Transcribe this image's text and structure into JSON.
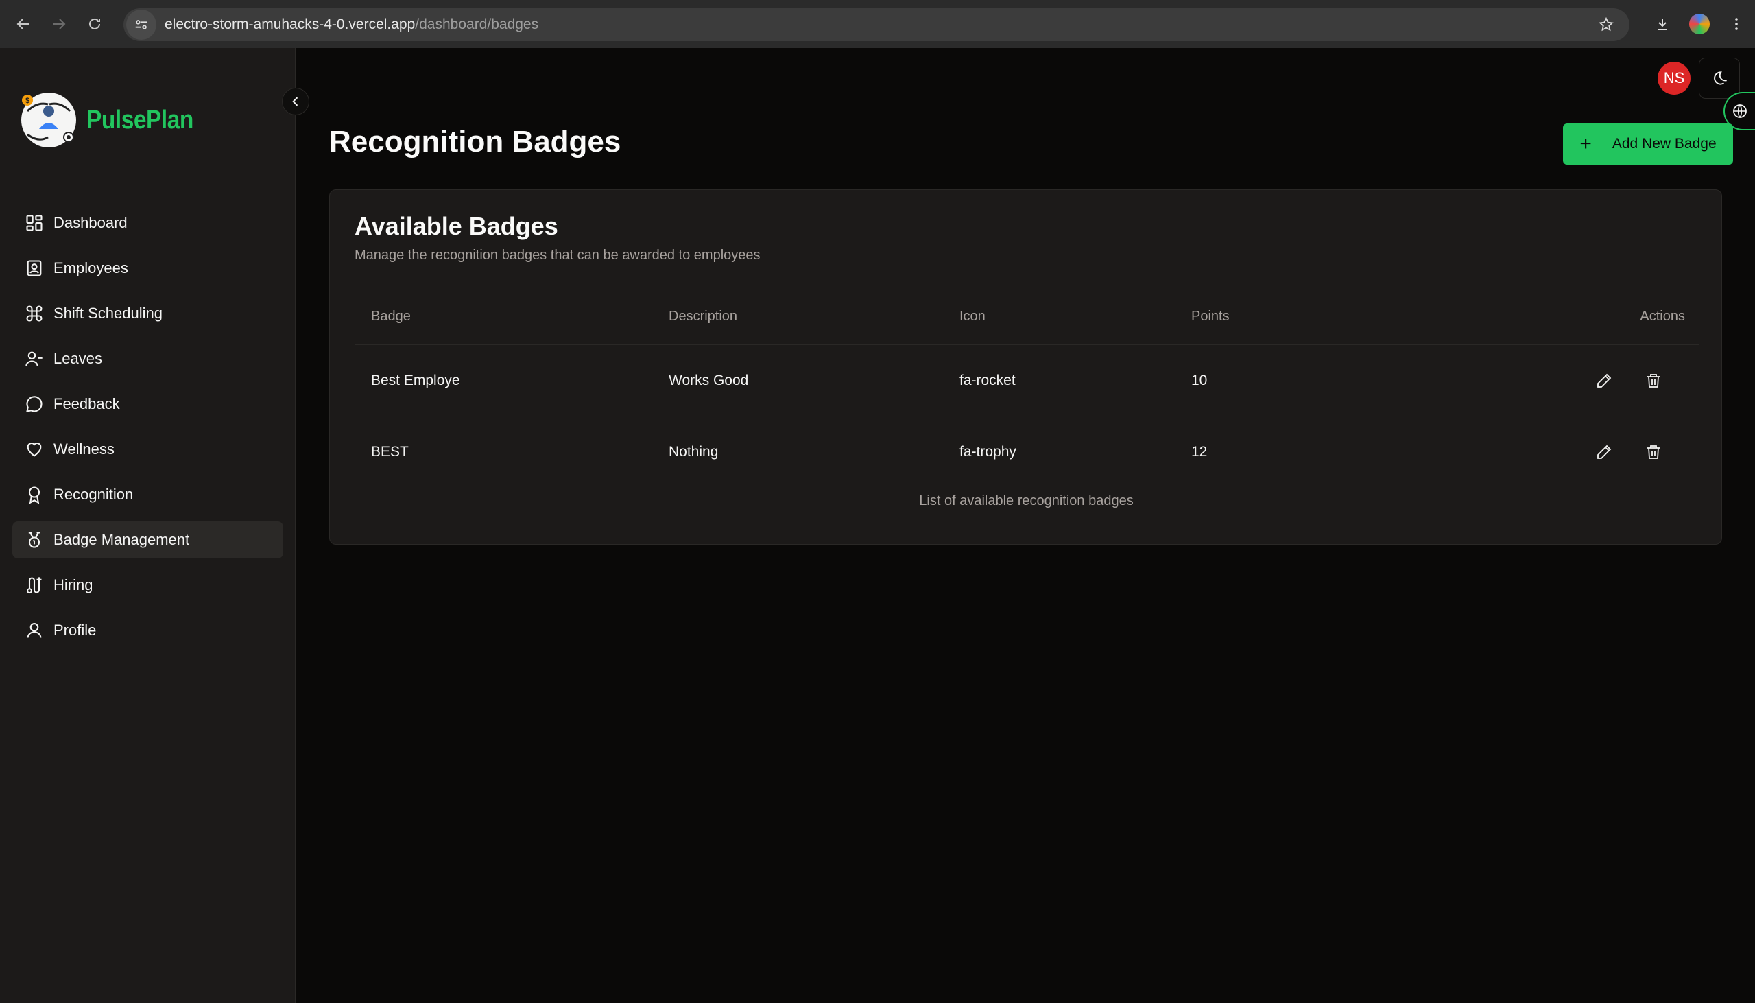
{
  "browser": {
    "url_host": "electro-storm-amuhacks-4-0.vercel.app",
    "url_path": "/dashboard/badges"
  },
  "brand": {
    "name": "PulsePlan"
  },
  "sidebar": {
    "items": [
      {
        "label": "Dashboard",
        "icon": "dashboard-icon"
      },
      {
        "label": "Employees",
        "icon": "contact-book-icon"
      },
      {
        "label": "Shift Scheduling",
        "icon": "command-icon"
      },
      {
        "label": "Leaves",
        "icon": "user-minus-icon"
      },
      {
        "label": "Feedback",
        "icon": "message-circle-icon"
      },
      {
        "label": "Wellness",
        "icon": "heart-icon"
      },
      {
        "label": "Recognition",
        "icon": "award-icon"
      },
      {
        "label": "Badge Management",
        "icon": "medal-icon",
        "active": true
      },
      {
        "label": "Hiring",
        "icon": "route-icon"
      },
      {
        "label": "Profile",
        "icon": "user-icon"
      }
    ]
  },
  "header": {
    "avatar_initials": "NS",
    "avatar_color": "#dc2626"
  },
  "page": {
    "title": "Recognition Badges",
    "add_button_label": "Add New Badge",
    "accent": "#22c55e"
  },
  "card": {
    "title": "Available Badges",
    "description": "Manage the recognition badges that can be awarded to employees",
    "columns": [
      "Badge",
      "Description",
      "Icon",
      "Points",
      "Actions"
    ],
    "rows": [
      {
        "badge": "Best Employe",
        "description": "Works Good",
        "icon": "fa-rocket",
        "points": "10"
      },
      {
        "badge": "BEST",
        "description": "Nothing",
        "icon": "fa-trophy",
        "points": "12"
      }
    ],
    "caption": "List of available recognition badges"
  }
}
